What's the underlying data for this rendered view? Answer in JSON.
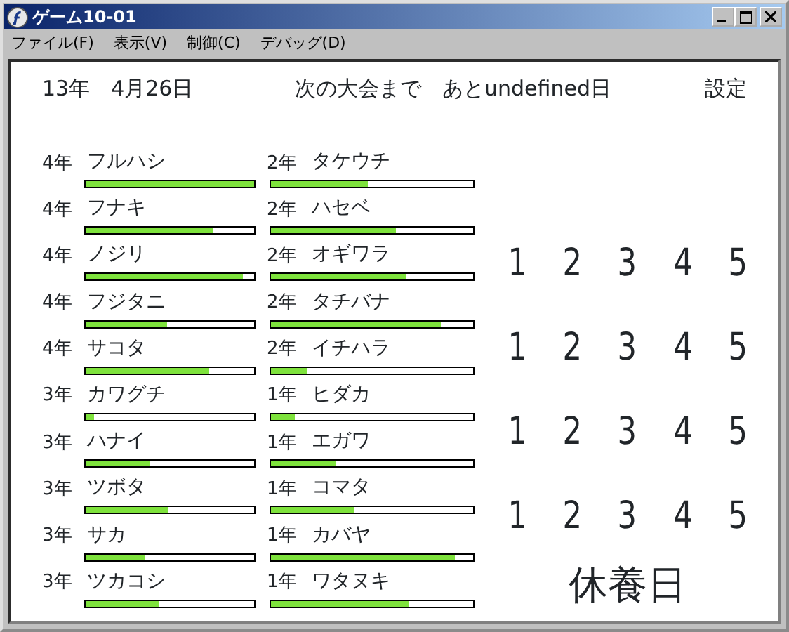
{
  "window": {
    "title": "ゲーム10-01"
  },
  "menu": [
    "ファイル(F)",
    "表示(V)",
    "制御(C)",
    "デバッグ(D)"
  ],
  "header": {
    "date": "13年　4月26日",
    "next_event": "次の大会まで　あとundefined日",
    "settings": "設定"
  },
  "players": [
    {
      "grade": "4年",
      "name": "フルハシ",
      "level": 1.0
    },
    {
      "grade": "2年",
      "name": "タケウチ",
      "level": 0.48
    },
    {
      "grade": "4年",
      "name": "フナキ",
      "level": 0.76
    },
    {
      "grade": "2年",
      "name": "ハセベ",
      "level": 0.62
    },
    {
      "grade": "4年",
      "name": "ノジリ",
      "level": 0.93
    },
    {
      "grade": "2年",
      "name": "オギワラ",
      "level": 0.67
    },
    {
      "grade": "4年",
      "name": "フジタニ",
      "level": 0.48
    },
    {
      "grade": "2年",
      "name": "タチバナ",
      "level": 0.84
    },
    {
      "grade": "4年",
      "name": "サコタ",
      "level": 0.73
    },
    {
      "grade": "2年",
      "name": "イチハラ",
      "level": 0.18
    },
    {
      "grade": "3年",
      "name": "カワグチ",
      "level": 0.05
    },
    {
      "grade": "1年",
      "name": "ヒダカ",
      "level": 0.12
    },
    {
      "grade": "3年",
      "name": "ハナイ",
      "level": 0.38
    },
    {
      "grade": "1年",
      "name": "エガワ",
      "level": 0.32
    },
    {
      "grade": "3年",
      "name": "ツボタ",
      "level": 0.49
    },
    {
      "grade": "1年",
      "name": "コマタ",
      "level": 0.41
    },
    {
      "grade": "3年",
      "name": "サカ",
      "level": 0.35
    },
    {
      "grade": "1年",
      "name": "カバヤ",
      "level": 0.91
    },
    {
      "grade": "3年",
      "name": "ツカコシ",
      "level": 0.43
    },
    {
      "grade": "1年",
      "name": "ワタヌキ",
      "level": 0.68
    }
  ],
  "number_rows": [
    [
      "1",
      "2",
      "3",
      "4",
      "5"
    ],
    [
      "1",
      "2",
      "3",
      "4",
      "5"
    ],
    [
      "1",
      "2",
      "3",
      "4",
      "5"
    ],
    [
      "1",
      "2",
      "3",
      "4",
      "5"
    ]
  ],
  "rest_day": "休養日"
}
